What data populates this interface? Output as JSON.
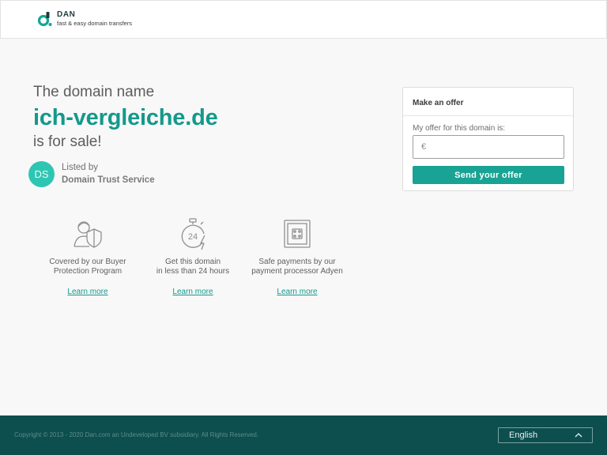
{
  "header": {
    "logo_name": "DAN",
    "logo_tagline": "fast & easy domain transfers"
  },
  "hero": {
    "pre": "The domain name",
    "domain": "ich-vergleiche.de",
    "post": "is for sale!"
  },
  "seller": {
    "initials": "DS",
    "listed_by": "Listed by",
    "name": "Domain Trust Service"
  },
  "features": [
    {
      "line1": "Covered by our Buyer",
      "line2": "Protection Program",
      "link": "Learn more",
      "icon": "shield-person-icon"
    },
    {
      "line1": "Get this domain",
      "line2": "in less than 24 hours",
      "link": "Learn more",
      "icon": "stopwatch-24-icon"
    },
    {
      "line1": "Safe payments by our",
      "line2": "payment processor Adyen",
      "link": "Learn more",
      "icon": "safe-icon"
    }
  ],
  "offer": {
    "title": "Make an offer",
    "label": "My offer for this domain is:",
    "placeholder": "€",
    "value": "",
    "button": "Send your offer"
  },
  "footer": {
    "copyright": "Copyright © 2013 - 2020 Dan.com an Undeveloped BV subsidiary. All Rights Reserved.",
    "language": "English"
  },
  "colors": {
    "accent": "#13998c",
    "button": "#18a395",
    "avatar": "#2ec6b2",
    "footer": "#0d4e4e"
  }
}
